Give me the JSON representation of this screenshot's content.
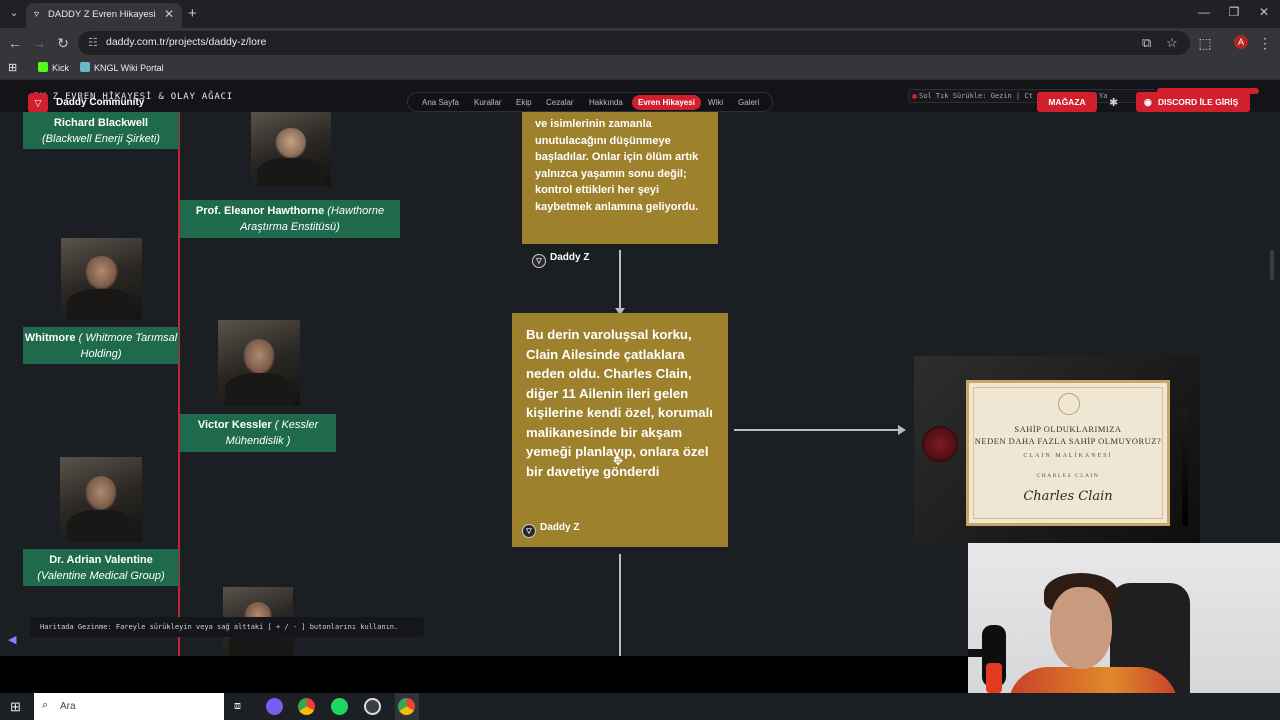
{
  "browser": {
    "tab_title": "DADDY Z Evren Hikayesi & Wh",
    "url": "daddy.com.tr/projects/daddy-z/lore",
    "avatar_letter": "A",
    "bookmarks": [
      "Kick",
      "KNGL Wiki Portal"
    ]
  },
  "site": {
    "header_title": "DY Z EVREN HİKAYESİ & OLAY AĞACI",
    "brand": "Daddy Community",
    "nav": [
      "Ana Sayfa",
      "Kurallar",
      "Ekip",
      "Cezalar",
      "Hakkında",
      "Evren Hikayesi",
      "Wiki",
      "Galeri"
    ],
    "nav_active": "Evren Hikayesi",
    "hint": "Sol Tık Sürükle: Gezin | Ct",
    "hint_right": "Ya",
    "shop_button": "MAĞAZA",
    "discord_button": "DISCORD İLE GİRİŞ",
    "accent_color": "#d11f2e"
  },
  "people": [
    {
      "name": "Richard Blackwell",
      "company": "(Blackwell Enerji Şirketi)"
    },
    {
      "name": "Prof. Eleanor Hawthorne",
      "company": "(Hawthorne Araştırma Enstitüsü)"
    },
    {
      "name": "Whitmore",
      "company": "( Whitmore Tarımsal Holding)"
    },
    {
      "name": "Victor Kessler",
      "company": "( Kessler Mühendislik )"
    },
    {
      "name": "Dr. Adrian Valentine",
      "company": "(Valentine Medical Group)"
    }
  ],
  "story": {
    "card1_text": "ve isimlerinin zamanla unutulacağını düşünmeye başladılar. Onlar için ölüm artık yalnızca yaşamın sonu değil; kontrol ettikleri her şeyi kaybetmek anlamına geliyordu.",
    "card1_author": "Daddy Z",
    "card2_text": "Bu derin varoluşsal korku, Clain Ailesinde çatlaklara neden oldu. Charles Clain, diğer 11 Ailenin ileri gelen kişilerine kendi özel, korumalı malikanesinde bir akşam yemeği planlayıp, onlara özel bir davetiye gönderdi",
    "card2_author": "Daddy Z"
  },
  "letter": {
    "line1": "SAHİP OLDUKLARIMIZA",
    "line2": "NEDEN DAHA FAZLA SAHİP OLMUYORUZ?",
    "line3": "CLAIN MALİKANESİ",
    "line4": "CHARLES CLAIN",
    "signature": "Charles Clain"
  },
  "tip": "Haritada Gezinme: Fareyle sürükleyin veya sağ alttaki [ + / - ] butonlarını kullanın.",
  "taskbar": {
    "search_placeholder": "Ara"
  }
}
